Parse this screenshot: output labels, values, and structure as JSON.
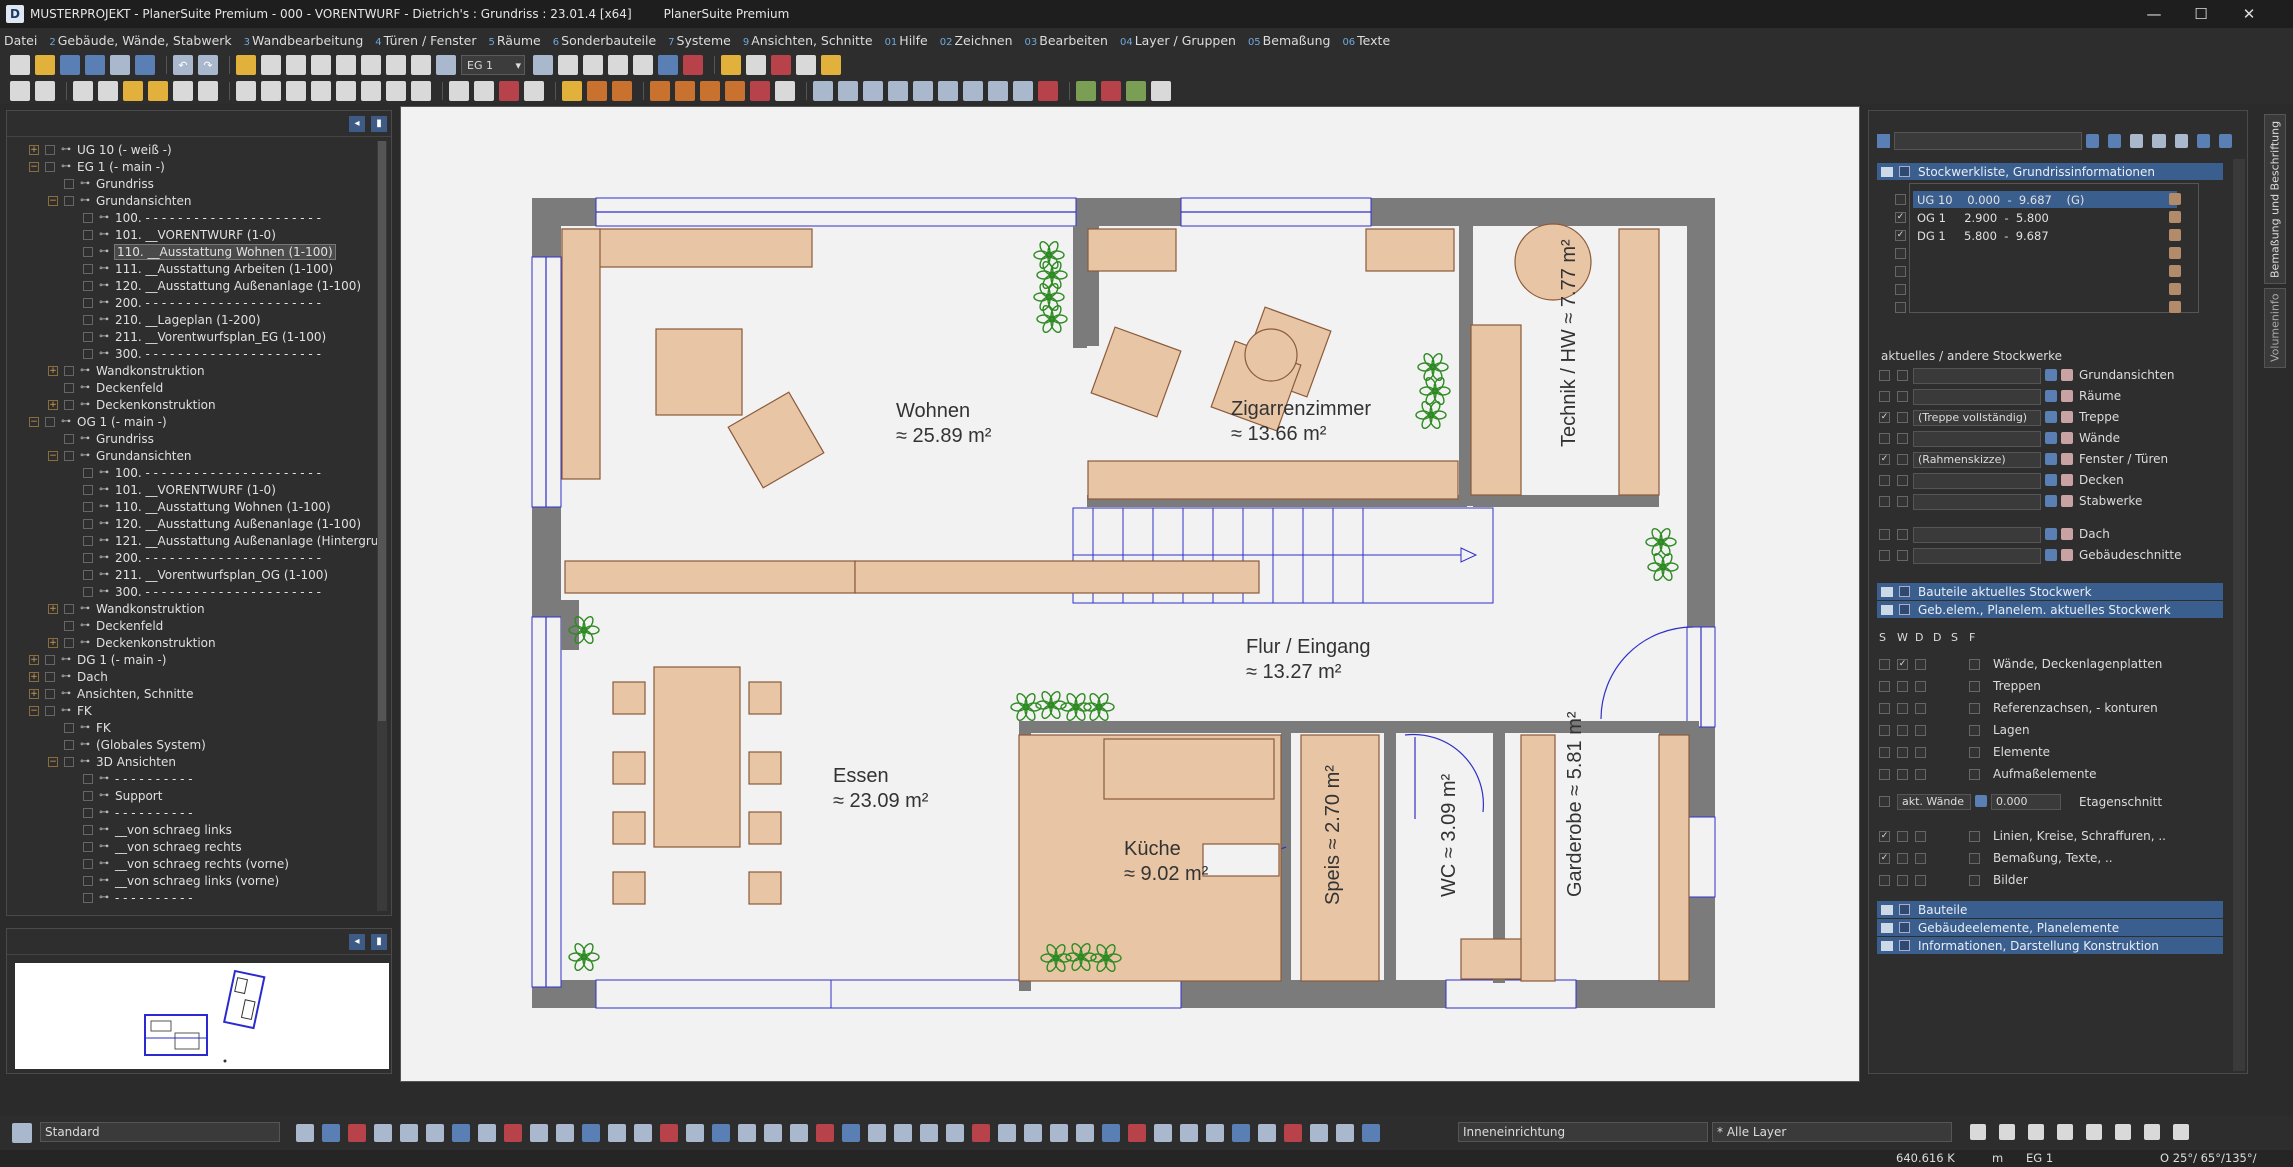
{
  "window": {
    "title": "MUSTERPROJEKT - PlanerSuite Premium - 000 - VORENTWURF - Dietrich's : Grundriss : 23.01.4 [x64]",
    "app_name": "PlanerSuite Premium",
    "icon_letter": "D",
    "minimize": "—",
    "maximize": "☐",
    "close": "✕"
  },
  "menu": [
    {
      "num": "",
      "label": "Datei"
    },
    {
      "num": "2",
      "label": "Gebäude, Wände, Stabwerk"
    },
    {
      "num": "3",
      "label": "Wandbearbeitung"
    },
    {
      "num": "4",
      "label": "Türen / Fenster"
    },
    {
      "num": "5",
      "label": "Räume"
    },
    {
      "num": "6",
      "label": "Sonderbauteile"
    },
    {
      "num": "7",
      "label": "Systeme"
    },
    {
      "num": "9",
      "label": "Ansichten, Schnitte"
    },
    {
      "num": "01",
      "label": "Hilfe"
    },
    {
      "num": "02",
      "label": "Zeichnen"
    },
    {
      "num": "03",
      "label": "Bearbeiten"
    },
    {
      "num": "04",
      "label": "Layer / Gruppen"
    },
    {
      "num": "05",
      "label": "Bemaßung"
    },
    {
      "num": "06",
      "label": "Texte"
    }
  ],
  "toolbar": {
    "floor_value": "EG 1"
  },
  "tree": [
    {
      "lvl": 0,
      "exp": "+",
      "label": "UG 10 (- weiß -)"
    },
    {
      "lvl": 0,
      "exp": "−",
      "label": "EG 1 (- main -)"
    },
    {
      "lvl": 1,
      "exp": "",
      "label": "Grundriss"
    },
    {
      "lvl": 1,
      "exp": "−",
      "label": "Grundansichten"
    },
    {
      "lvl": 2,
      "exp": "",
      "label": "100. - - - - - - - - - - - - - - - - - - - - - -"
    },
    {
      "lvl": 2,
      "exp": "",
      "label": "101. __VORENTWURF (1-0)"
    },
    {
      "lvl": 2,
      "exp": "",
      "label": "110. __Ausstattung Wohnen (1-100)",
      "sel": true
    },
    {
      "lvl": 2,
      "exp": "",
      "label": "111. __Ausstattung Arbeiten (1-100)"
    },
    {
      "lvl": 2,
      "exp": "",
      "label": "120. __Ausstattung Außenanlage (1-100)"
    },
    {
      "lvl": 2,
      "exp": "",
      "label": "200. - - - - - - - - - - - - - - - - - - - - - -"
    },
    {
      "lvl": 2,
      "exp": "",
      "label": "210. __Lageplan (1-200)"
    },
    {
      "lvl": 2,
      "exp": "",
      "label": "211. __Vorentwurfsplan_EG (1-100)"
    },
    {
      "lvl": 2,
      "exp": "",
      "label": "300. - - - - - - - - - - - - - - - - - - - - - -"
    },
    {
      "lvl": 1,
      "exp": "+",
      "label": "Wandkonstruktion"
    },
    {
      "lvl": 1,
      "exp": "",
      "label": "Deckenfeld"
    },
    {
      "lvl": 1,
      "exp": "+",
      "label": "Deckenkonstruktion"
    },
    {
      "lvl": 0,
      "exp": "−",
      "label": "OG 1 (- main -)"
    },
    {
      "lvl": 1,
      "exp": "",
      "label": "Grundriss"
    },
    {
      "lvl": 1,
      "exp": "−",
      "label": "Grundansichten"
    },
    {
      "lvl": 2,
      "exp": "",
      "label": "100. - - - - - - - - - - - - - - - - - - - - - -"
    },
    {
      "lvl": 2,
      "exp": "",
      "label": "101. __VORENTWURF (1-0)"
    },
    {
      "lvl": 2,
      "exp": "",
      "label": "110. __Ausstattung Wohnen (1-100)"
    },
    {
      "lvl": 2,
      "exp": "",
      "label": "120. __Ausstattung Außenanlage (1-100)"
    },
    {
      "lvl": 2,
      "exp": "",
      "label": "121. __Ausstattung Außenanlage (Hintergru"
    },
    {
      "lvl": 2,
      "exp": "",
      "label": "200. - - - - - - - - - - - - - - - - - - - - - -"
    },
    {
      "lvl": 2,
      "exp": "",
      "label": "211. __Vorentwurfsplan_OG (1-100)"
    },
    {
      "lvl": 2,
      "exp": "",
      "label": "300. - - - - - - - - - - - - - - - - - - - - - -"
    },
    {
      "lvl": 1,
      "exp": "+",
      "label": "Wandkonstruktion"
    },
    {
      "lvl": 1,
      "exp": "",
      "label": "Deckenfeld"
    },
    {
      "lvl": 1,
      "exp": "+",
      "label": "Deckenkonstruktion"
    },
    {
      "lvl": 0,
      "exp": "+",
      "label": "DG 1 (- main -)"
    },
    {
      "lvl": 0,
      "exp": "+",
      "label": "Dach"
    },
    {
      "lvl": 0,
      "exp": "+",
      "label": "Ansichten, Schnitte"
    },
    {
      "lvl": 0,
      "exp": "−",
      "label": "FK"
    },
    {
      "lvl": 1,
      "exp": "",
      "label": "FK"
    },
    {
      "lvl": 1,
      "exp": "",
      "label": "(Globales System)"
    },
    {
      "lvl": 1,
      "exp": "−",
      "label": "3D Ansichten"
    },
    {
      "lvl": 2,
      "exp": "",
      "label": "- - - - - - - - - -"
    },
    {
      "lvl": 2,
      "exp": "",
      "label": "Support"
    },
    {
      "lvl": 2,
      "exp": "",
      "label": "- - - - - - - - - -"
    },
    {
      "lvl": 2,
      "exp": "",
      "label": "__von schraeg links"
    },
    {
      "lvl": 2,
      "exp": "",
      "label": "__von schraeg rechts"
    },
    {
      "lvl": 2,
      "exp": "",
      "label": "__von schraeg rechts (vorne)"
    },
    {
      "lvl": 2,
      "exp": "",
      "label": "__von schraeg links (vorne)"
    },
    {
      "lvl": 2,
      "exp": "",
      "label": "- - - - - - - - - -"
    }
  ],
  "rooms": [
    {
      "id": "wohnen",
      "name": "Wohnen",
      "area": "≈ 25.89 m²"
    },
    {
      "id": "zigarren",
      "name": "Zigarrenzimmer",
      "area": "≈ 13.66 m²"
    },
    {
      "id": "technik",
      "name": "Technik / HW",
      "area": "≈ 7.77 m²"
    },
    {
      "id": "flur",
      "name": "Flur / Eingang",
      "area": "≈ 13.27 m²"
    },
    {
      "id": "essen",
      "name": "Essen",
      "area": "≈ 23.09 m²"
    },
    {
      "id": "kueche",
      "name": "Küche",
      "area": "≈ 9.02 m²"
    },
    {
      "id": "speis",
      "name": "Speis",
      "area": "≈ 2.70 m²"
    },
    {
      "id": "wc",
      "name": "WC",
      "area": "≈ 3.09 m²"
    },
    {
      "id": "garderobe",
      "name": "Garderobe",
      "area": "≈ 5.81 m²"
    }
  ],
  "right_panel": {
    "stories_header": "Stockwerkliste, Grundrissinformationen",
    "stories": [
      {
        "label": "UG 10    0.000  -  9.687    (G)",
        "checked": false,
        "sel": true
      },
      {
        "label": "OG 1     2.900  -  5.800",
        "checked": true,
        "sel": false
      },
      {
        "label": "DG 1     5.800  -  9.687",
        "checked": true,
        "sel": false
      }
    ],
    "section_other": "aktuelles / andere Stockwerke",
    "other_rows": [
      {
        "value": "",
        "label": "Grundansichten",
        "checked": false
      },
      {
        "value": "",
        "label": "Räume",
        "checked": false
      },
      {
        "value": "(Treppe vollständig)",
        "label": "Treppe",
        "checked": true
      },
      {
        "value": "",
        "label": "Wände",
        "checked": false
      },
      {
        "value": "(Rahmenskizze)",
        "label": "Fenster / Türen",
        "checked": true
      },
      {
        "value": "",
        "label": "Decken",
        "checked": false
      },
      {
        "value": "",
        "label": "Stabwerke",
        "checked": false
      },
      {
        "value": "",
        "label": "Dach",
        "checked": false
      },
      {
        "value": "",
        "label": "Gebäudeschnitte",
        "checked": false
      }
    ],
    "bar_bauteile_akt": "Bauteile aktuelles Stockwerk",
    "bar_geb_akt": "Geb.elem., Planelem. aktuelles Stockwerk",
    "col_headers": [
      "S",
      "W",
      "D",
      "D",
      "S",
      "F"
    ],
    "elem_rows": [
      "Wände, Deckenlagenplatten",
      "Treppen",
      "Referenzachsen, - konturen",
      "Lagen",
      "Elemente",
      "Aufmaßelemente"
    ],
    "etagen_select": "akt. Wände",
    "etagen_value": "0.000",
    "etagen_label": "Etagenschnitt",
    "misc_rows": [
      {
        "label": "Linien, Kreise, Schraffuren, ..",
        "checked": true
      },
      {
        "label": "Bemaßung, Texte, ..",
        "checked": true
      },
      {
        "label": "Bilder",
        "checked": false
      }
    ],
    "bottom_bars": [
      "Bauteile",
      "Gebäudeelemente, Planelemente",
      "Informationen, Darstellung Konstruktion"
    ]
  },
  "side_tabs": [
    "Bemaßung und Beschriftung",
    "Volumeninfo"
  ],
  "statusbar": {
    "style": "Standard",
    "room_style": "Inneneinrichtung",
    "layer": "* Alle Layer"
  },
  "infobar": {
    "coords": "640.616 K",
    "unit": "m",
    "floor": "EG 1",
    "angle": "O 25°/ 65°/135°/"
  },
  "colors": {
    "wall": "#7b7b7b",
    "furniture": "#e8c6a5",
    "furniture_stroke": "#8a5a3a",
    "window": "#3030c8",
    "plant": "#3a8a2a"
  }
}
